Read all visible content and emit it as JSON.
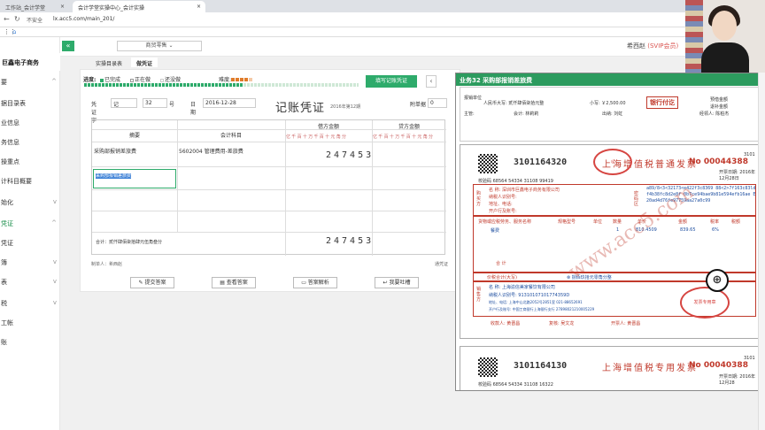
{
  "browser": {
    "tabs": [
      {
        "label": "工作站_会计学堂"
      },
      {
        "label": "会计学堂实操中心_会计实操"
      }
    ],
    "security": "不安全",
    "url": "lx.acc5.com/main_201/"
  },
  "sidebar": {
    "company": "巨鑫电子商务",
    "items": [
      {
        "label": "要",
        "arrow": "^"
      },
      {
        "label": "据目录表"
      },
      {
        "label": "业信息"
      },
      {
        "label": "务信息"
      },
      {
        "label": "操重点"
      },
      {
        "label": "计科目概要"
      },
      {
        "label": "始化",
        "arrow": "v"
      },
      {
        "label": "凭证",
        "arrow": "^",
        "active": true
      },
      {
        "label": "凭证"
      },
      {
        "label": "簿",
        "arrow": "v"
      },
      {
        "label": "表",
        "arrow": "v"
      },
      {
        "label": "税",
        "arrow": "v"
      },
      {
        "label": "工帐"
      },
      {
        "label": "账"
      }
    ]
  },
  "topbar": {
    "collapse": "«",
    "company_select": "商贸零售 ⌄",
    "user": "希西赵",
    "vip": "(SVIP会员)"
  },
  "subtabs": [
    {
      "label": "实操目录表"
    },
    {
      "label": "做凭证",
      "active": true
    }
  ],
  "progress": {
    "label": "进度:",
    "done": "已完成",
    "in_progress": "正在做",
    "not_done": "还没做",
    "difficulty_label": "难度:",
    "difficulty_level": 4,
    "difficulty_max": 5,
    "fill_fraction": 0.58,
    "fill_button": "填写记账凭证",
    "prev": "‹"
  },
  "voucher": {
    "word_label": "凭证字",
    "word": "记",
    "number": "32",
    "number_suffix": "号",
    "date_label": "日期",
    "date": "2016-12-28",
    "title": "记账凭证",
    "period": "2016年第12期",
    "attach_label": "附单据",
    "attach": "0",
    "headers": {
      "summary": "摘要",
      "account": "会计科目",
      "debit": "借方金额",
      "credit": "贷方金额"
    },
    "digit_header": "亿千百十万千百十元角分",
    "rows": [
      {
        "summary": "采购部报销差旅费",
        "account": "5602004 管理费用-差旅费",
        "debit": "247453"
      }
    ],
    "selected_cell": "采购部报销差旅费",
    "total_label": "合计：贰仟肆佰柒拾肆元伍角叁分",
    "total_debit": "247453",
    "maker_label": "制单人：希西赵",
    "right_note": "通凭证"
  },
  "actions": [
    {
      "label": "提交答案",
      "icon": "edit-icon"
    },
    {
      "label": "查看答案",
      "icon": "database-icon"
    },
    {
      "label": "答案解析",
      "icon": "folder-icon"
    },
    {
      "label": "我要吐槽",
      "icon": "reply-icon"
    }
  ],
  "docpanel": {
    "title": "业务32 采购部报销差旅费",
    "top_doc": {
      "amount_words": "人民币大写: 贰仟肆佰柒拾元整",
      "small": "小写: ￥2,500.00",
      "stamp": "银行付讫",
      "manager": "主管:",
      "accountant": "会计: 林莉莉",
      "cashier": "出纳: 刘虹",
      "handler": "经领人: 陈柏杰",
      "refund": "预借金额",
      "return": "退补金额",
      "report_unit": "报销单位"
    },
    "invoice1": {
      "code": "3101164320",
      "title": "上海增值税普通发票",
      "no_label": "No",
      "number": "00044388",
      "side_no": "3101",
      "date": "开票日期: 2016年12月28日",
      "check": "校验码 68564 54334 31108 99419",
      "buyer_name": "名  称: 深圳市巨鑫电子商务有限公司",
      "buyer_tax": "纳税人识别号:",
      "buyer_addr": "地址、电话:",
      "buyer_bank": "开户行及账号:",
      "cipher": "a89/8<3<32173<e422f3c8369 88<2>7f163c83ldf4b38fc8d2e8f 0b7ce94bae9b81e594efb16ae E20ad4d76fe97759aa27a0c99",
      "item_header": "货物或应税劳务、服务名称",
      "spec_header": "规格型号",
      "unit_header": "单位",
      "qty_header": "数量",
      "price_header": "单价",
      "amount_header": "金额",
      "rate_header": "税率",
      "tax_header": "税额",
      "item": "餐费",
      "qty": "1",
      "price": "810.4509",
      "amount": "839.65",
      "rate": "6%",
      "total_label": "合  计",
      "total_words_label": "价税合计(大写)",
      "total_words": "⊗ 捌佰玖拾元零角分整",
      "seller_name": "名  称: 上海渝信美家餐饮有限公司",
      "seller_tax": "纳税人识别号: 91310107101774359D",
      "seller_addr": "地址、电话: 上海中山北路2052号2851室 021-88652691",
      "seller_bank": "开户行及账号: 中国工商银行上海银行支行 27898021210005229",
      "payee": "收款人: 黄晋昌",
      "reviewer": "复核: 吴文龙",
      "issuer": "开票人: 黄晋昌",
      "seller_label": "销售方",
      "stamp": "发票专用章",
      "buyer_label": "购买方",
      "cipher_label": "密码区"
    },
    "invoice2": {
      "code": "3101164130",
      "title": "上海增值税专用发票",
      "no_label": "No",
      "number": "00040388",
      "side_no": "3101",
      "date": "开票日期: 2016年12月28",
      "check": "校验码 68564 54334 31108 16322"
    },
    "watermark": "www.acc5.com"
  },
  "colors": {
    "accent": "#2eab6b",
    "invoice_red": "#c0392b",
    "vip": "#d9534f"
  }
}
